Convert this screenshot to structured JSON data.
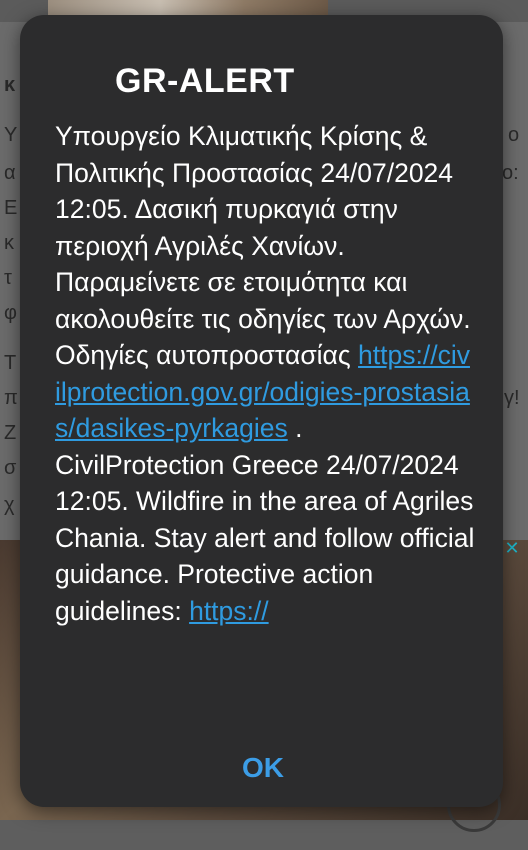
{
  "background": {
    "side_letters_left": [
      "κ",
      "Υ",
      "α",
      "Ε",
      "κ",
      "τ",
      "φ",
      "Τ",
      "π",
      "Ζ",
      "σ",
      "χ"
    ],
    "side_letters_right": [
      "ο",
      "ο:",
      "γ!"
    ]
  },
  "alert": {
    "title": "GR-ALERT",
    "message_greek_part1": "Υπουργείο Κλιματικής Κρίσης & Πολιτικής Προστασίας 24/07/2024 12:05. Δασική πυρκαγιά στην περιοχή Αγριλές Χανίων. Παραμείνετε σε ετοιμότητα και ακολουθείτε τις οδηγίες των Αρχών. Οδηγίες αυτοπροστασίας",
    "link_greek": "https://civilprotection.gov.gr/odigies-prostasias/dasikes-pyrkagies",
    "message_english": " .  CivilProtection Greece 24/07/2024 12:05. Wildfire in the area of Agriles Chania. Stay alert and follow official guidance. Protective action guidelines: ",
    "link_english": "https://",
    "ok_label": "OK"
  },
  "colors": {
    "dialog_bg": "#2c2c2d",
    "link": "#2f9be0",
    "ok": "#3c9de6",
    "ad_close": "#1fb4c8"
  },
  "icons": {
    "ad_close": "close-icon"
  }
}
